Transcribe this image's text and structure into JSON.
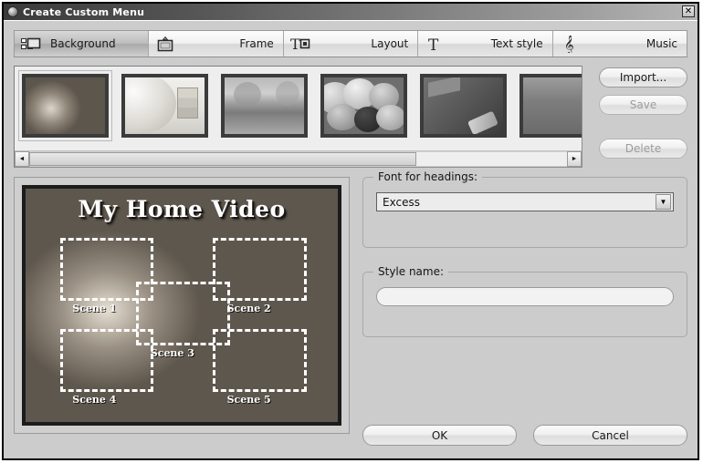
{
  "window": {
    "title": "Create Custom Menu",
    "icon": "app-disc-icon",
    "close_label": "✕"
  },
  "tabs": [
    {
      "label": "Background",
      "icon": "background-icon",
      "selected": true
    },
    {
      "label": "Frame",
      "icon": "frame-icon",
      "selected": false
    },
    {
      "label": "Layout",
      "icon": "text-layout-icon",
      "selected": false
    },
    {
      "label": "Text style",
      "icon": "text-style-icon",
      "selected": false
    },
    {
      "label": "Music",
      "icon": "music-note-icon",
      "selected": false
    }
  ],
  "thumbnails": [
    {
      "name": "baby-shoes",
      "selected": true
    },
    {
      "name": "sphere-blocks",
      "selected": false
    },
    {
      "name": "hearts",
      "selected": false
    },
    {
      "name": "balloons",
      "selected": false
    },
    {
      "name": "graduation-cap",
      "selected": false
    },
    {
      "name": "misc-partial",
      "selected": false
    }
  ],
  "scrollbar": {
    "left_arrow": "◄",
    "right_arrow": "►",
    "thumb_percent": 72
  },
  "side_buttons": [
    {
      "label": "Import...",
      "enabled": true
    },
    {
      "label": "Save",
      "enabled": false
    },
    {
      "label": "Delete",
      "enabled": false
    }
  ],
  "preview": {
    "title": "My Home Video",
    "scenes": [
      {
        "label": "Scene 1"
      },
      {
        "label": "Scene 2"
      },
      {
        "label": "Scene 3"
      },
      {
        "label": "Scene 4"
      },
      {
        "label": "Scene 5"
      }
    ]
  },
  "font_group": {
    "title": "Font for headings:",
    "selected": "Excess",
    "arrow": "▼"
  },
  "style_group": {
    "title": "Style name:",
    "value": "",
    "placeholder": ""
  },
  "dialog_buttons": {
    "ok": "OK",
    "cancel": "Cancel"
  },
  "colors": {
    "dialog_face": "#cccccc",
    "titlebar_dark": "#3a3a3a",
    "titlebar_light": "#b5b5b5",
    "disabled_text": "#9c9c9c"
  }
}
